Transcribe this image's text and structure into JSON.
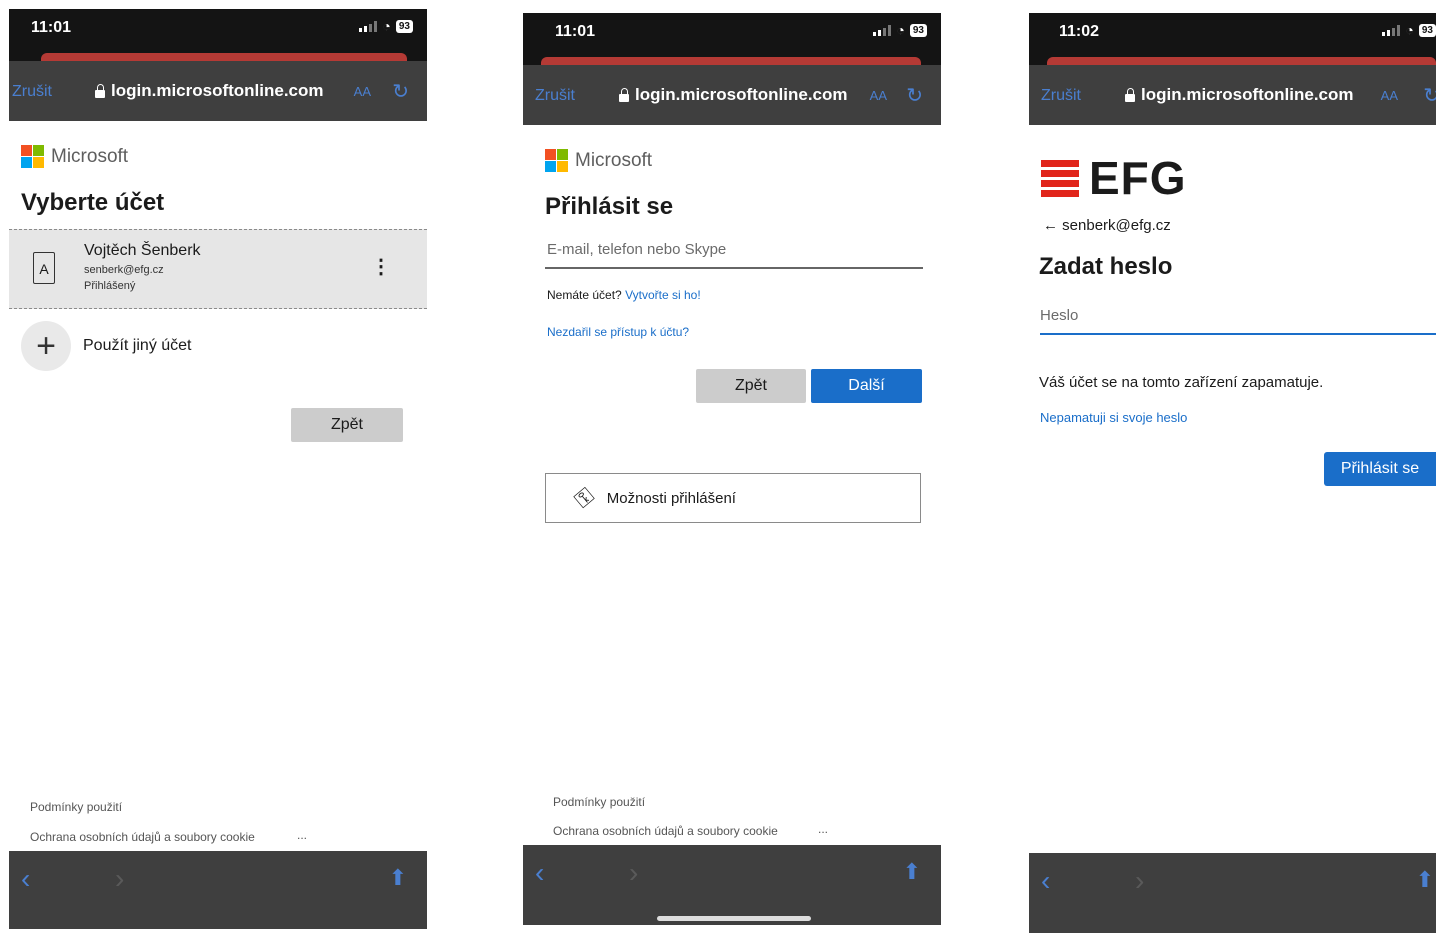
{
  "status": {
    "battery": "93"
  },
  "browser": {
    "cancel": "Zrušit",
    "url": "login.microsoftonline.com",
    "aa": "AA"
  },
  "brand": {
    "microsoft": "Microsoft",
    "efg": "EFG"
  },
  "screen1": {
    "time": "11:01",
    "heading": "Vyberte účet",
    "account": {
      "name": "Vojtěch Šenberk",
      "email": "senberk@efg.cz",
      "state": "Přihlášený"
    },
    "other_account": "Použít jiný účet",
    "back_button": "Zpět",
    "footer_terms": "Podmínky použití",
    "footer_privacy": "Ochrana osobních údajů a soubory cookie",
    "footer_more": "..."
  },
  "screen2": {
    "time": "11:01",
    "heading": "Přihlásit se",
    "email_placeholder": "E-mail, telefon nebo Skype",
    "no_account": "Nemáte účet?",
    "create_link": "Vytvořte si ho!",
    "cant_access": "Nezdařil se přístup k účtu?",
    "back_button": "Zpět",
    "next_button": "Další",
    "signin_options": "Možnosti přihlášení",
    "footer_terms": "Podmínky použití",
    "footer_privacy": "Ochrana osobních údajů a soubory cookie",
    "footer_more": "..."
  },
  "screen3": {
    "time": "11:02",
    "back_email": "← senberk@efg.cz",
    "heading": "Zadat heslo",
    "password_placeholder": "Heslo",
    "remember_text": "Váš účet se na tomto zařízení zapamatuje.",
    "dont_remember_link": "Nepamatuji si svoje heslo",
    "signin_button": "Přihlásit se"
  },
  "colors": {
    "accent": "#1a6ec9",
    "efg_red": "#e1251b",
    "browser_bar": "#3f3f3f"
  }
}
